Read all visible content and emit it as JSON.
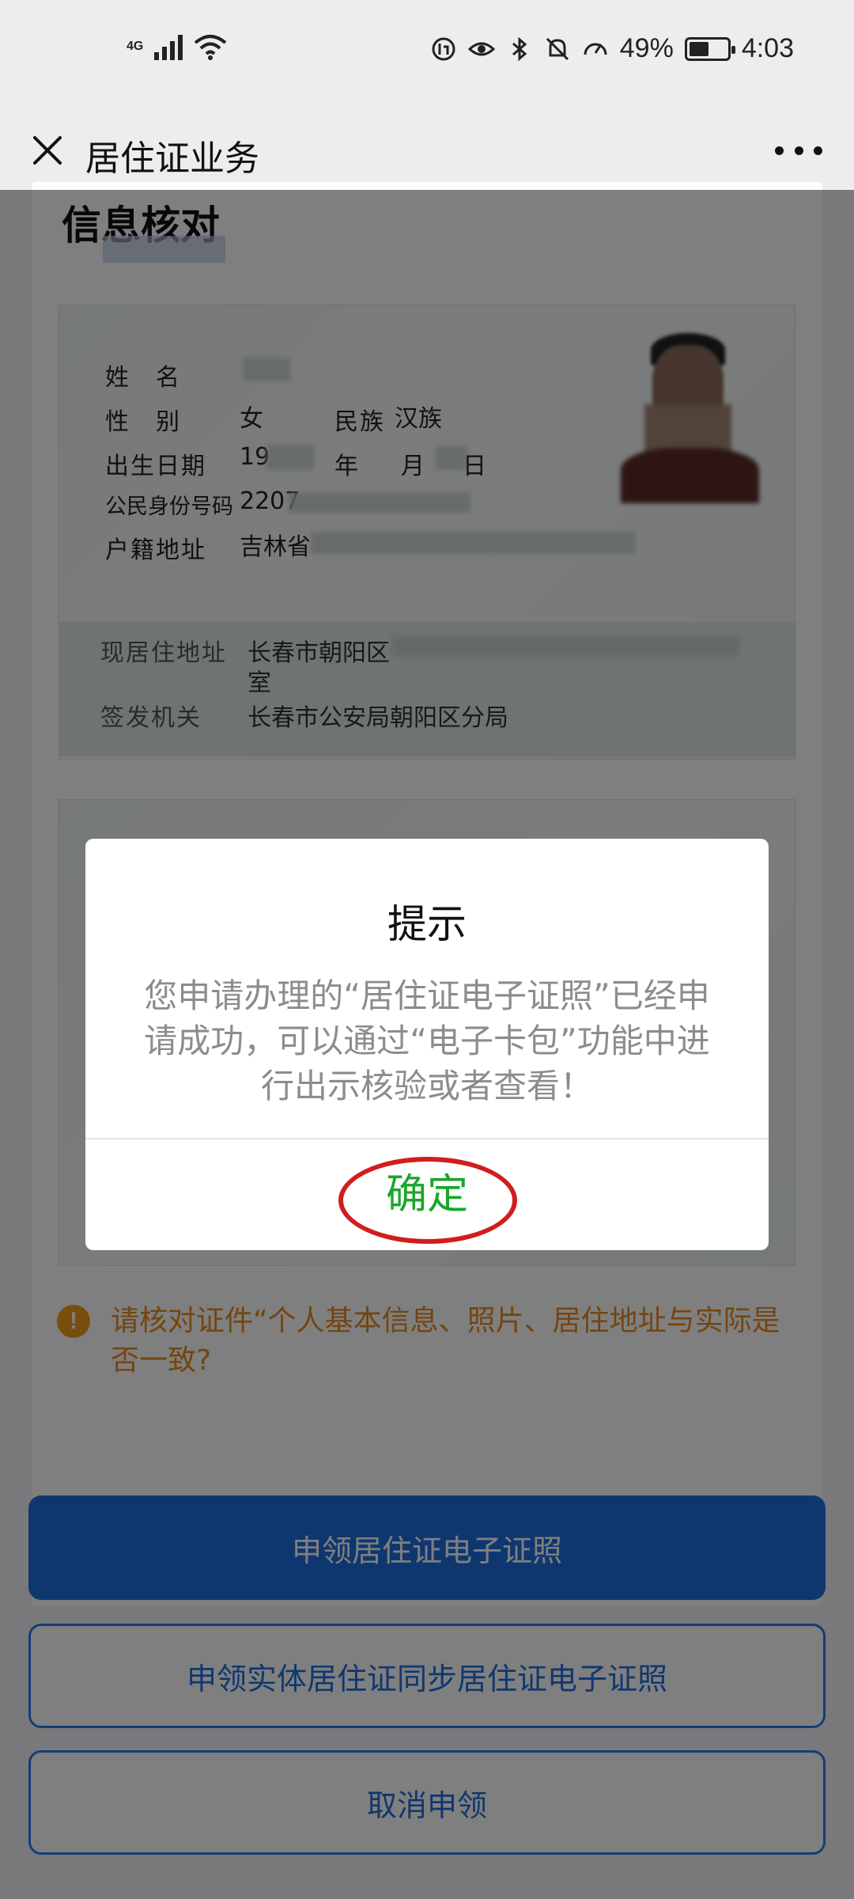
{
  "status_bar": {
    "network": "4G",
    "battery": "49%",
    "time": "4:03"
  },
  "nav": {
    "title": "居住证业务"
  },
  "page": {
    "section_title": "信息核对",
    "id_card": {
      "name_label": "姓　名",
      "gender_label": "性　别",
      "gender_value": "女",
      "ethnicity_label": "民族",
      "ethnicity_value": "汉族",
      "birth_label": "出生日期",
      "birth_value_prefix": "19",
      "birth_year_unit": "年",
      "birth_month_unit": "月",
      "birth_day_unit": "日",
      "id_number_label": "公民身份号码",
      "id_number_prefix": "2207",
      "household_label": "户籍地址",
      "household_value_prefix": "吉林省",
      "residence_label": "现居住地址",
      "residence_value_prefix": "长春市朝阳区",
      "residence_value_suffix": "室",
      "issuer_label": "签发机关",
      "issuer_value": "长春市公安局朝阳区分局"
    },
    "notice": "请核对证件“个人基本信息、照片、居住地址与实际是否一致?",
    "buttons": {
      "apply": "申领居住证电子证照",
      "apply_sync": "申领实体居住证同步居住证电子证照",
      "cancel": "取消申领"
    }
  },
  "dialog": {
    "title": "提示",
    "message": "您申请办理的“居住证电子证照”已经申请成功，可以通过“电子卡包”功能中进行出示核验或者查看！",
    "confirm": "确定"
  },
  "colors": {
    "primary": "#1e6fdf",
    "confirm_green": "#1aa62c",
    "notice_orange": "#e98a1e",
    "highlight_red": "#d01e1e"
  }
}
